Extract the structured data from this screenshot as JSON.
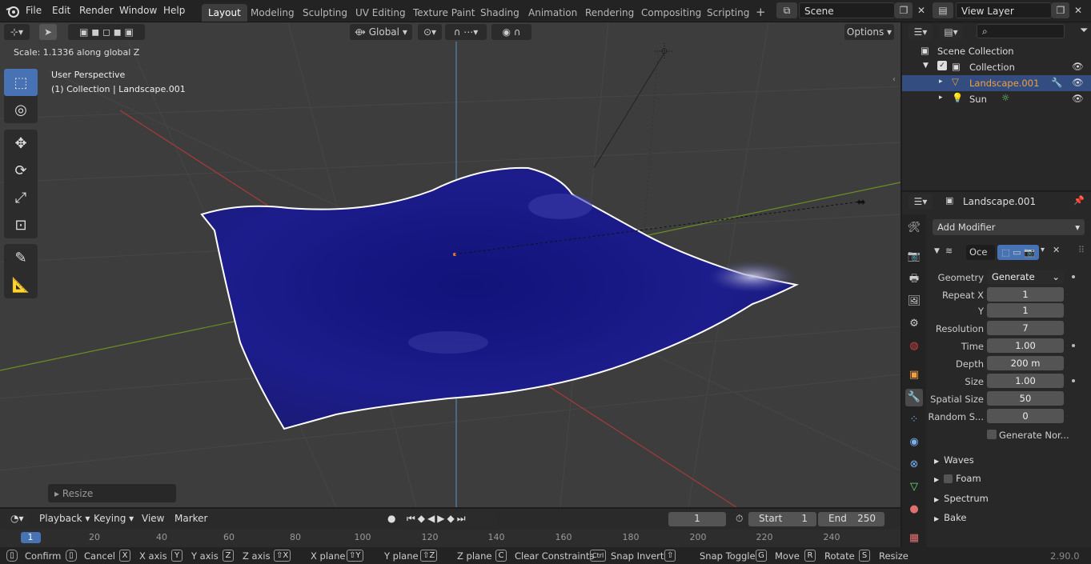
{
  "menu": [
    "File",
    "Edit",
    "Render",
    "Window",
    "Help"
  ],
  "workspaces": [
    "Layout",
    "Modeling",
    "Sculpting",
    "UV Editing",
    "Texture Paint",
    "Shading",
    "Animation",
    "Rendering",
    "Compositing",
    "Scripting"
  ],
  "active_workspace": "Layout",
  "scene": "Scene",
  "view_layer": "View Layer",
  "viewport": {
    "orientation": "Global",
    "options_label": "Options",
    "status": "Scale: 1.1336 along global Z",
    "perspective": "User Perspective",
    "collection_info": "(1) Collection | Landscape.001",
    "operator_panel": "Resize"
  },
  "outliner": {
    "scene_collection": "Scene Collection",
    "collection": "Collection",
    "objects": [
      {
        "name": "Landscape.001",
        "selected": true
      },
      {
        "name": "Sun",
        "selected": false
      }
    ]
  },
  "properties": {
    "object_name": "Landscape.001",
    "add_modifier": "Add Modifier",
    "modifier_name": "Oce",
    "fields": [
      {
        "label": "Geometry",
        "value": "Generate",
        "type": "dropdown",
        "dot": true
      },
      {
        "label": "Repeat X",
        "value": "1",
        "dot": false
      },
      {
        "label": "Y",
        "value": "1",
        "dot": false
      },
      {
        "label": "Resolution",
        "value": "7",
        "dot": false
      },
      {
        "label": "Time",
        "value": "1.00",
        "dot": true
      },
      {
        "label": "Depth",
        "value": "200 m",
        "dot": false
      },
      {
        "label": "Size",
        "value": "1.00",
        "dot": true
      },
      {
        "label": "Spatial Size",
        "value": "50",
        "dot": false
      },
      {
        "label": "Random S...",
        "value": "0",
        "dot": false
      }
    ],
    "generate_normals": "Generate Nor...",
    "subpanels": [
      "Waves",
      "Foam",
      "Spectrum",
      "Bake"
    ]
  },
  "timeline": {
    "playback": "Playback",
    "keying": "Keying",
    "view": "View",
    "marker": "Marker",
    "current_frame": "1",
    "start_label": "Start",
    "start": "1",
    "end_label": "End",
    "end": "250",
    "ruler": [
      "1",
      "20",
      "40",
      "60",
      "80",
      "100",
      "120",
      "140",
      "160",
      "180",
      "200",
      "220",
      "240"
    ]
  },
  "statusbar": {
    "items": [
      {
        "key": "",
        "label": "Confirm"
      },
      {
        "key": "",
        "label": "Cancel"
      },
      {
        "key": "X",
        "label": "X axis"
      },
      {
        "key": "Y",
        "label": "Y axis"
      },
      {
        "key": "Z",
        "label": "Z axis"
      },
      {
        "key": "⇧X",
        "label": "X plane"
      },
      {
        "key": "⇧Y",
        "label": "Y plane"
      },
      {
        "key": "⇧Z",
        "label": "Z plane"
      },
      {
        "key": "C",
        "label": "Clear Constraints"
      },
      {
        "key": "Ctrl",
        "label": "Snap Invert"
      },
      {
        "key": "⇧",
        "label": "Snap Toggle"
      },
      {
        "key": "G",
        "label": "Move"
      },
      {
        "key": "R",
        "label": "Rotate"
      },
      {
        "key": "S",
        "label": "Resize"
      }
    ],
    "version": "2.90.0"
  },
  "colors": {
    "accent": "#4772b3",
    "selection": "#334d80",
    "object_orange": "#f0a040",
    "mesh": "#1a1a80"
  }
}
